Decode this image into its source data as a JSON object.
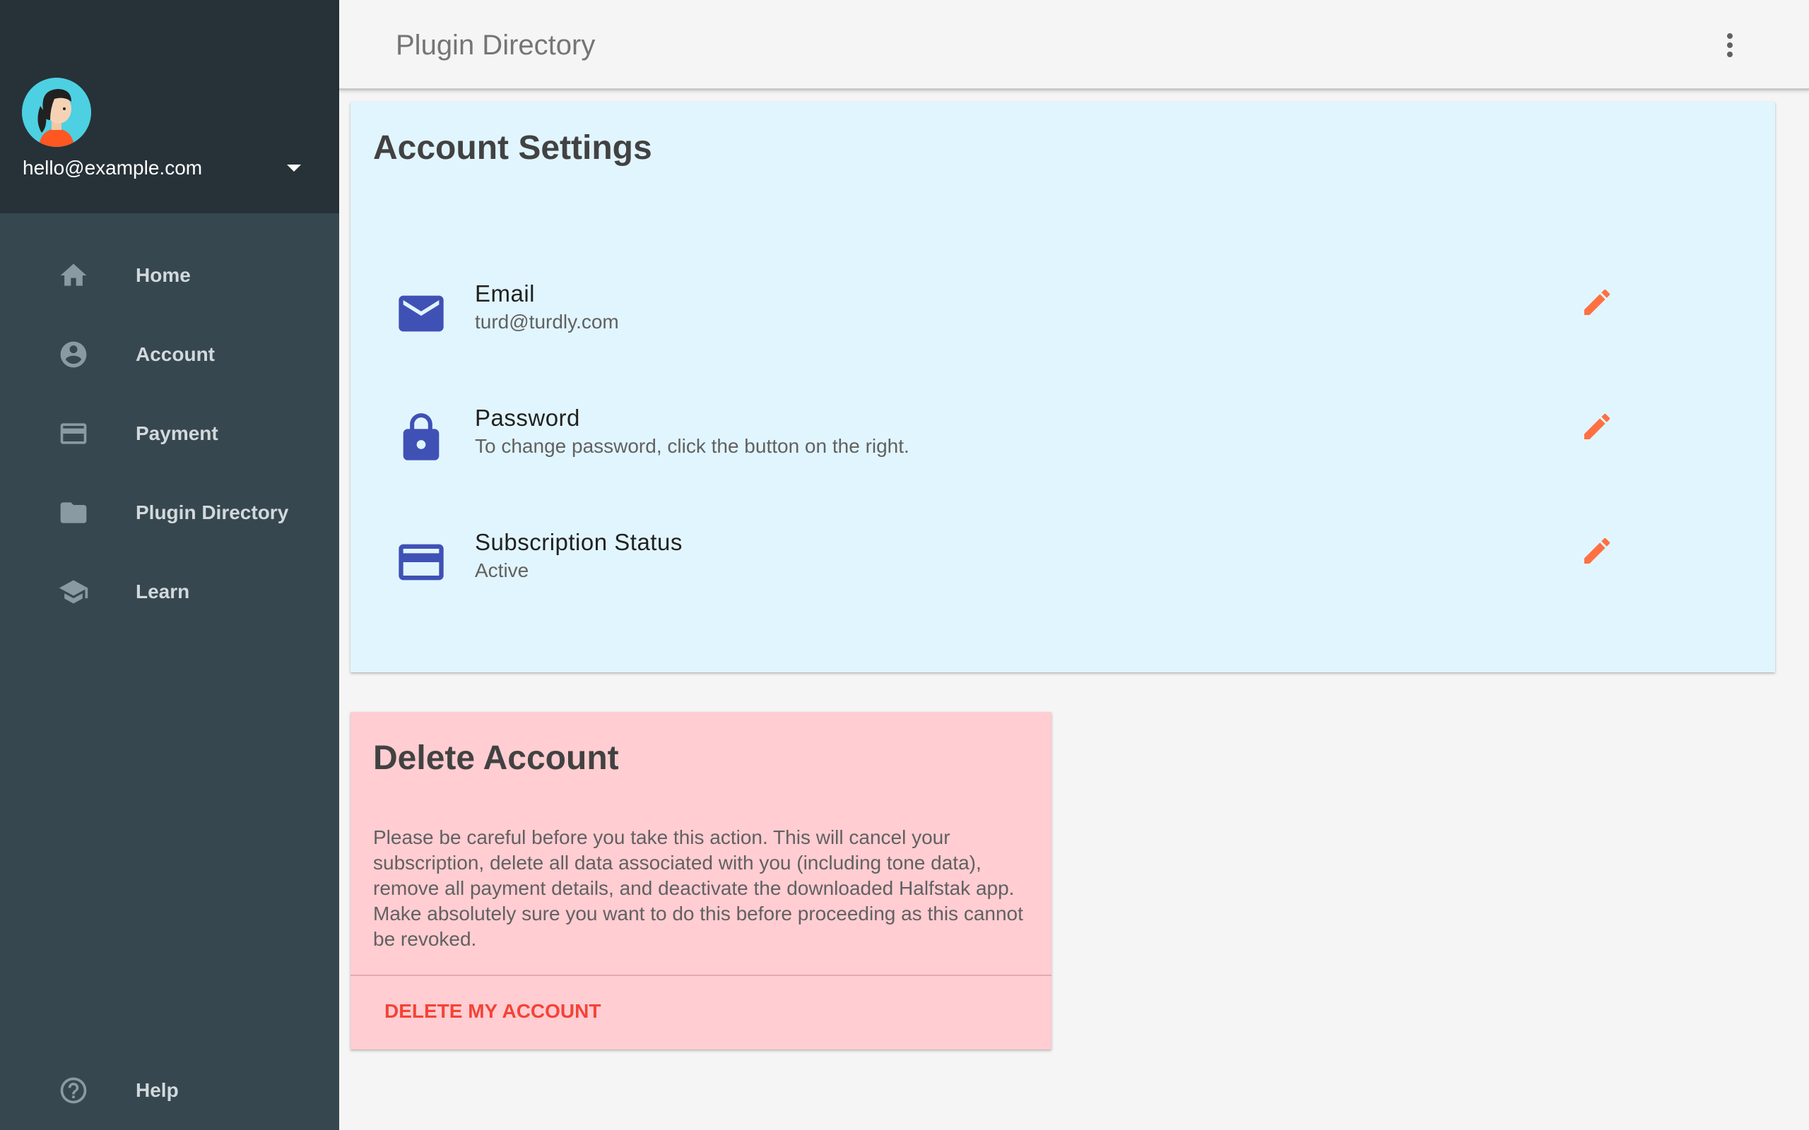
{
  "sidebar": {
    "user_email": "hello@example.com",
    "nav_items": [
      {
        "label": "Home",
        "icon": "home-icon"
      },
      {
        "label": "Account",
        "icon": "account-circle-icon"
      },
      {
        "label": "Payment",
        "icon": "credit-card-icon"
      },
      {
        "label": "Plugin Directory",
        "icon": "folder-icon"
      },
      {
        "label": "Learn",
        "icon": "school-icon"
      }
    ],
    "help": {
      "label": "Help",
      "icon": "help-icon"
    }
  },
  "topbar": {
    "title": "Plugin Directory"
  },
  "account_settings": {
    "title": "Account Settings",
    "rows": [
      {
        "label": "Email",
        "value": "turd@turdly.com",
        "icon": "email-icon"
      },
      {
        "label": "Password",
        "value": "To change password, click the button on the right.",
        "icon": "lock-icon"
      },
      {
        "label": "Subscription Status",
        "value": "Active",
        "icon": "credit-card-icon"
      }
    ]
  },
  "delete_account": {
    "title": "Delete Account",
    "description": "Please be careful before you take this action. This will cancel your subscription, delete all data associated with you (including tone data), remove all payment details, and deactivate the downloaded Halfstak app. Make absolutely sure you want to do this before proceeding as this cannot be revoked.",
    "button_label": "DELETE MY ACCOUNT"
  },
  "colors": {
    "sidebar_bg": "#37474f",
    "sidebar_header_bg": "#263238",
    "settings_card_bg": "#e1f5fe",
    "delete_card_bg": "#ffcdd2",
    "icon_primary": "#3f51b5",
    "edit_accent": "#ff7043",
    "danger": "#f44336"
  }
}
